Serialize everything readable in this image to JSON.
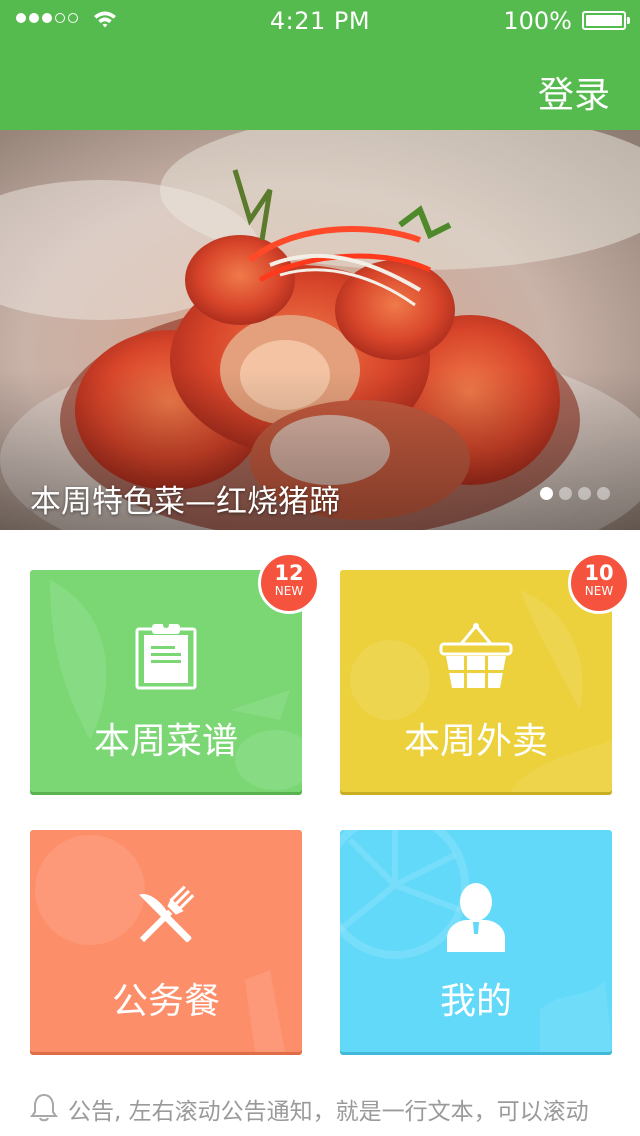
{
  "status_bar": {
    "time": "4:21 PM",
    "battery": "100%",
    "signal_filled": 3,
    "signal_total": 5,
    "icons": [
      "signal-dots-icon",
      "wifi-icon",
      "battery-icon"
    ]
  },
  "header": {
    "login_label": "登录",
    "color": "#56bb4e"
  },
  "banner": {
    "caption": "本周特色菜—红烧猪蹄",
    "page_count": 4,
    "active_page": 1
  },
  "tiles": [
    {
      "label": "本周菜谱",
      "icon": "clipboard-icon",
      "badge_count": "12",
      "badge_text": "NEW",
      "color": "#7ad774"
    },
    {
      "label": "本周外卖",
      "icon": "basket-icon",
      "badge_count": "10",
      "badge_text": "NEW",
      "color": "#ecd13c"
    },
    {
      "label": "公务餐",
      "icon": "fork-knife-icon",
      "color": "#fd8e6a"
    },
    {
      "label": "我的",
      "icon": "user-icon",
      "color": "#63d9fa"
    }
  ],
  "notice": {
    "icon": "bell-icon",
    "text": "公告, 左右滚动公告通知，就是一行文本，可以滚动"
  },
  "colors": {
    "badge": "#f5533d"
  }
}
